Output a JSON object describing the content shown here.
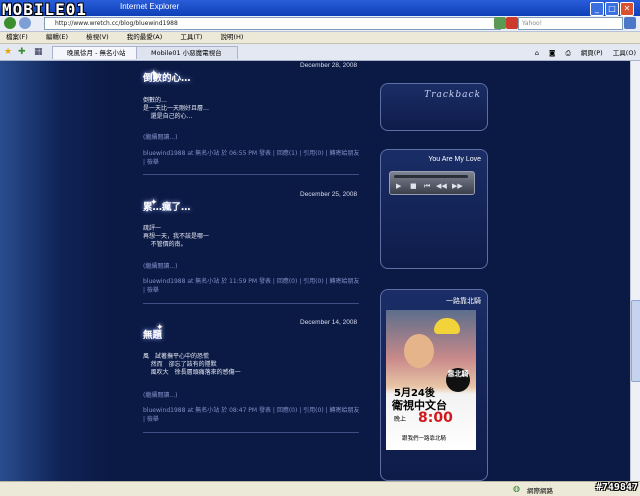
{
  "window": {
    "title": "Internet Explorer",
    "watermark": "MOBILE01"
  },
  "address_bar": {
    "url": "http://www.wretch.cc/blog/bluewind1988",
    "search_placeholder": "Yahoo!"
  },
  "menu": [
    "檔案(F)",
    "編輯(E)",
    "檢視(V)",
    "我的最愛(A)",
    "工具(T)",
    "說明(H)"
  ],
  "tabs": [
    {
      "label": "晚風徐月 - 無名小站"
    },
    {
      "label": "Mobile01 小惡魔電視台"
    }
  ],
  "toolbar": {
    "page": "網頁(P)",
    "tools": "工具(O)"
  },
  "posts": [
    {
      "date": "December 28, 2008",
      "title": "倒數的心…",
      "body": "倒數的…\n是一天比一天剛好且層…\n    還是自己的心…",
      "read_more": "(繼續閱讀...)",
      "author": "bluewind1988",
      "meta": " at 無名小站 於 06:55 PM 發表 | 回應(1) | 引用(0) | 轉寄給朋友 | 檢舉"
    },
    {
      "date": "December 25, 2008",
      "title": "累…瘋了…",
      "body": "疏評一\n再想一天，我不該是哪一\n    不管價的南。",
      "read_more": "(繼續閱讀...)",
      "author": "bluewind1988",
      "meta": " at 無名小站 於 11:59 PM 發表 | 回應(0) | 引用(0) | 轉寄給朋友 | 檢舉"
    },
    {
      "date": "December 14, 2008",
      "title": "無題",
      "body": "風　試著撫平心中的恐慌\n    然而　卻忘了該有的隱默\n    風吹大　徐長層頭痛落來的感傷一",
      "read_more": "(繼續閱讀...)",
      "author": "bluewind1988",
      "meta": " at 無名小站 於 08:47 PM 發表 | 回應(0) | 引用(0) | 轉寄給朋友 | 檢舉"
    }
  ],
  "widgets": {
    "trackback": {
      "label": "Trackback"
    },
    "music": {
      "title": "You Are My Love"
    },
    "poster": {
      "title": "一路靠北騎",
      "seal": "靠北騎",
      "date_line": "5月24後",
      "channel": "衛視中文台",
      "evening": "晚上",
      "time": "8:00",
      "tagline": "跟我們一路靠北騎"
    }
  },
  "status": {
    "zone": "網際網路",
    "tag": "#749847"
  }
}
